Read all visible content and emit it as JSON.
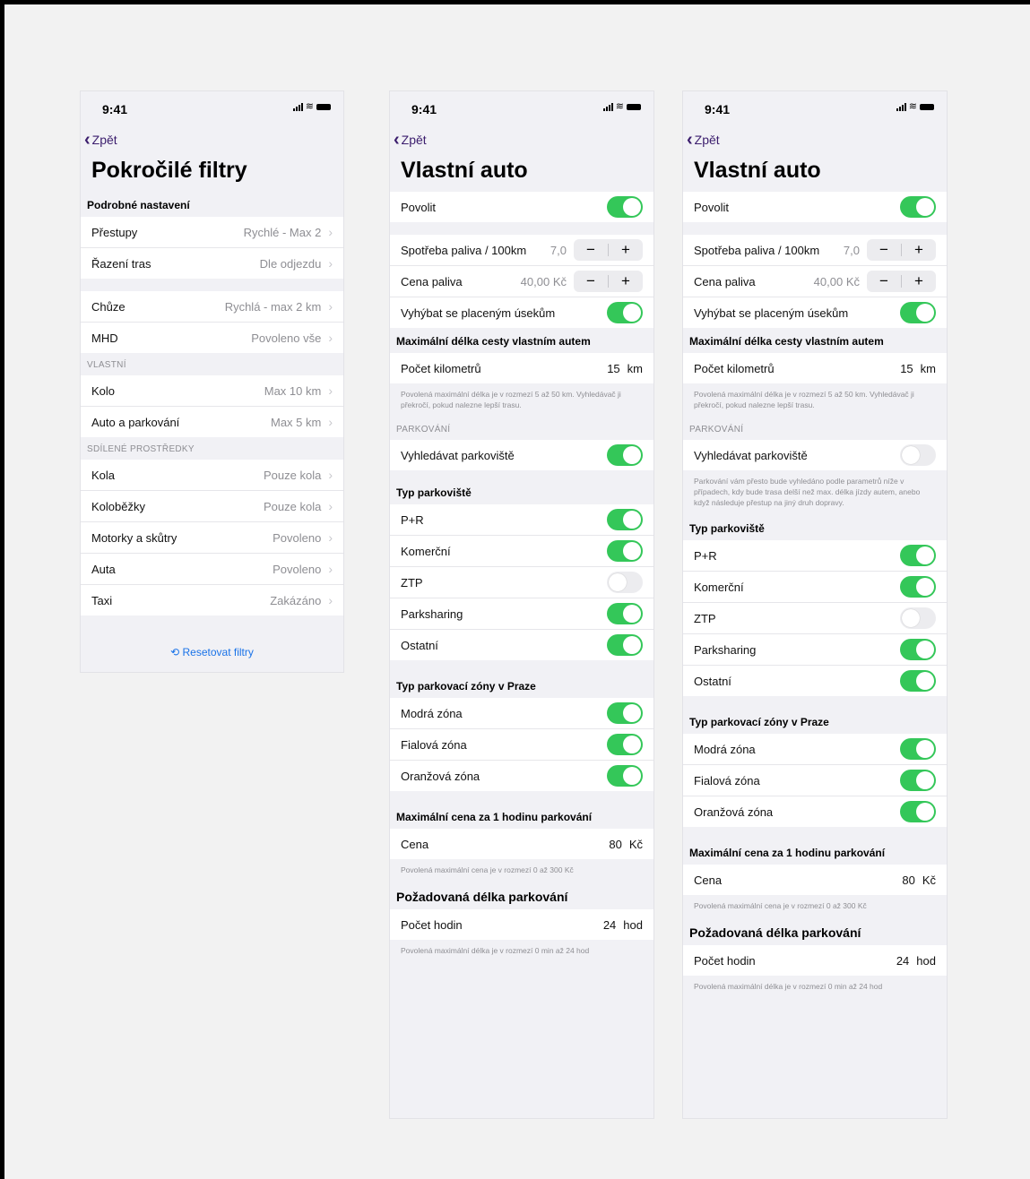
{
  "status": {
    "time": "9:41"
  },
  "screen1": {
    "back": "Zpět",
    "title": "Pokročilé filtry",
    "section1": "Podrobné nastavení",
    "rows1": [
      {
        "label": "Přestupy",
        "value": "Rychlé - Max 2"
      },
      {
        "label": "Řazení tras",
        "value": "Dle odjezdu"
      }
    ],
    "rows2": [
      {
        "label": "Chůze",
        "value": "Rychlá - max 2 km"
      },
      {
        "label": "MHD",
        "value": "Povoleno vše"
      }
    ],
    "section_own": "VLASTNÍ",
    "rows3": [
      {
        "label": "Kolo",
        "value": "Max 10 km"
      },
      {
        "label": "Auto a parkování",
        "value": "Max 5 km"
      }
    ],
    "section_shared": "SDÍLENÉ PROSTŘEDKY",
    "rows4": [
      {
        "label": "Kola",
        "value": "Pouze kola"
      },
      {
        "label": "Koloběžky",
        "value": "Pouze kola"
      },
      {
        "label": "Motorky a skůtry",
        "value": "Povoleno"
      },
      {
        "label": "Auta",
        "value": "Povoleno"
      },
      {
        "label": "Taxi",
        "value": "Zakázáno"
      }
    ],
    "reset": "Resetovat filtry",
    "reset_icon": "reset-icon"
  },
  "screen2": {
    "back": "Zpět",
    "title": "Vlastní auto",
    "enable": "Povolit",
    "fuel_label": "Spotřeba paliva / 100km",
    "fuel_value": "7,0",
    "price_label": "Cena paliva",
    "price_value": "40,00 Kč",
    "avoid": "Vyhýbat se placeným úsekům",
    "max_dist_header": "Maximální délka cesty vlastním autem",
    "km_label": "Počet kilometrů",
    "km_value": "15",
    "km_unit": "km",
    "km_note": "Povolená maximální délka je v rozmezí 5 až 50 km. Vyhledávač ji překročí, pokud nalezne lepší trasu.",
    "parking_header": "PARKOVÁNÍ",
    "search_parking": "Vyhledávat parkoviště",
    "type_header": "Typ parkoviště",
    "types": [
      {
        "label": "P+R",
        "on": true
      },
      {
        "label": "Komerční",
        "on": true
      },
      {
        "label": "ZTP",
        "on": false
      },
      {
        "label": "Parksharing",
        "on": true
      },
      {
        "label": "Ostatní",
        "on": true
      }
    ],
    "zone_header": "Typ parkovací zóny v Praze",
    "zones": [
      {
        "label": "Modrá zóna",
        "on": true
      },
      {
        "label": "Fialová zóna",
        "on": true
      },
      {
        "label": "Oranžová zóna",
        "on": true
      }
    ],
    "price_header": "Maximální cena za 1 hodinu parkování",
    "cena_label": "Cena",
    "cena_value": "80",
    "cena_unit": "Kč",
    "cena_note": "Povolená maximální cena je v rozmezí 0 až 300 Kč",
    "duration_header": "Požadovaná délka parkování",
    "hours_label": "Počet hodin",
    "hours_value": "24",
    "hours_unit": "hod",
    "hours_note": "Povolená maximální délka je v rozmezí 0 min až 24 hod"
  },
  "screen3": {
    "parking_note": "Parkování vám přesto bude vyhledáno podle parametrů níže v případech, kdy bude trasa delší než max. délka jízdy autem, anebo když následuje přestup na jiný druh dopravy."
  },
  "colors": {
    "toggle_on": "#34c759",
    "accent": "#3b1d6d",
    "link": "#1a73e8"
  }
}
